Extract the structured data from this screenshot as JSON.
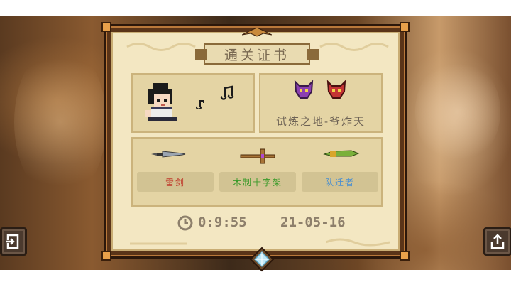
{
  "certificate": {
    "title": "通关证书",
    "stage_name": "试炼之地-爷炸天",
    "weapons": [
      {
        "label": "雷剑",
        "color": "#c0392b",
        "icon": "dagger-icon"
      },
      {
        "label": "木制十字架",
        "color": "#3a9a2a",
        "icon": "cross-staff-icon"
      },
      {
        "label": "队迁者",
        "color": "#4a8fd0",
        "icon": "green-blade-icon"
      }
    ],
    "clear_time": "0:9:55",
    "clear_date": "21-05-16"
  },
  "icons": {
    "left_button": "exit-icon",
    "right_button": "share-icon",
    "hero": "hero-avatar",
    "bosses": [
      "purple-demon-mask-icon",
      "red-demon-mask-icon"
    ]
  }
}
